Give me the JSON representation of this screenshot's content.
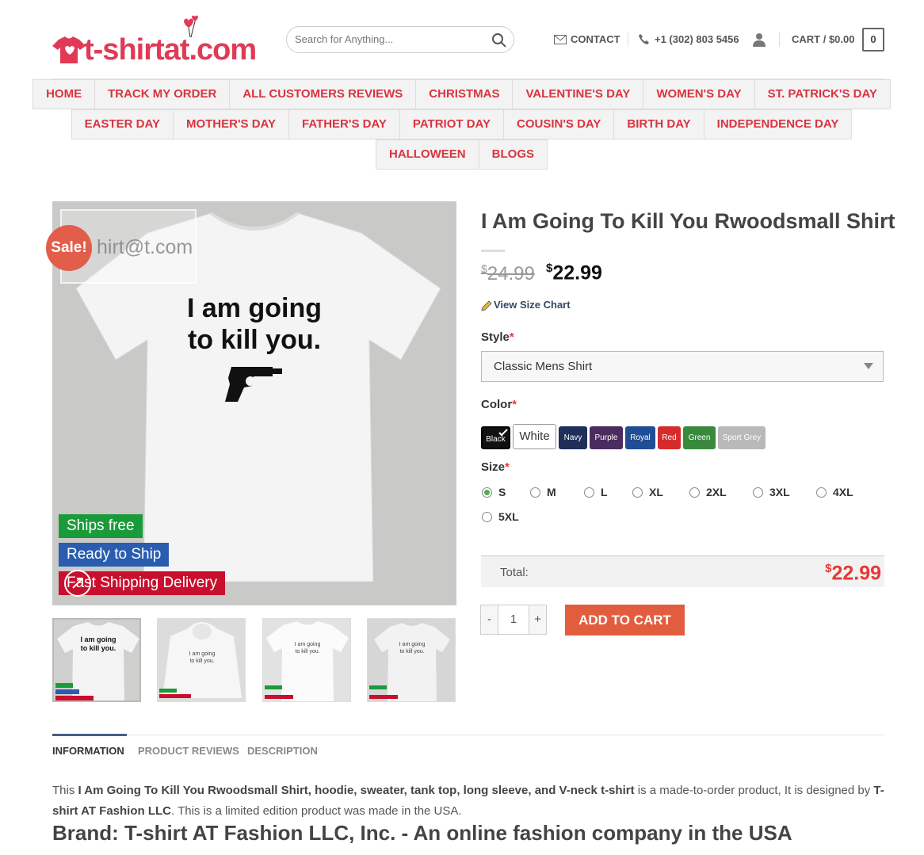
{
  "header": {
    "logo_text": "t-shirtat.com",
    "search_placeholder": "Search for Anything...",
    "contact_label": "CONTACT",
    "phone_label": "+1 (302) 803 5456",
    "cart_label": "CART / $0.00",
    "cart_count": "0"
  },
  "menu": {
    "row1": [
      "HOME",
      "TRACK MY ORDER",
      "ALL CUSTOMERS REVIEWS",
      "CHRISTMAS",
      "VALENTINE'S DAY",
      "WOMEN'S DAY",
      "ST. PATRICK'S DAY"
    ],
    "row2": [
      "EASTER DAY",
      "MOTHER'S DAY",
      "FATHER'S DAY",
      "PATRIOT DAY",
      "COUSIN'S DAY",
      "BIRTH DAY",
      "INDEPENDENCE DAY"
    ],
    "row3": [
      "HALLOWEEN",
      "BLOGS"
    ]
  },
  "gallery": {
    "sale_badge": "Sale!",
    "watermark": "hirt@t.com",
    "shirt_text_line1": "I am going",
    "shirt_text_line2": "to kill you.",
    "badges": [
      "Ships free",
      "Ready to Ship",
      "Fast Shipping Delivery"
    ],
    "thumb_text_line1": "I am going",
    "thumb_text_line2": "to kill you."
  },
  "product": {
    "title": "I Am Going To Kill You Rwoodsmall Shirt",
    "old_price_currency": "$",
    "old_price": "24.99",
    "price_currency": "$",
    "price": "22.99",
    "size_chart_link": "View Size Chart",
    "style_label": "Style",
    "style_selected": "Classic Mens Shirt",
    "color_label": "Color",
    "colors": [
      {
        "name": "Black",
        "hex": "#111111"
      },
      {
        "name": "White",
        "hex": "#ffffff"
      },
      {
        "name": "Navy",
        "hex": "#1f2f5a"
      },
      {
        "name": "Purple",
        "hex": "#4a2c5e"
      },
      {
        "name": "Royal",
        "hex": "#1f4d96"
      },
      {
        "name": "Red",
        "hex": "#d62b2b"
      },
      {
        "name": "Green",
        "hex": "#3a8a3e"
      },
      {
        "name": "Sport Grey",
        "hex": "#b9b9b9"
      }
    ],
    "selected_color": "Black",
    "size_label": "Size",
    "sizes": [
      "S",
      "M",
      "L",
      "XL",
      "2XL",
      "3XL",
      "4XL",
      "5XL"
    ],
    "selected_size": "S",
    "required_mark": "*",
    "total_label": "Total:",
    "total_currency": "$",
    "total_value": "22.99",
    "qty_minus": "-",
    "qty_value": "1",
    "qty_plus": "+",
    "add_to_cart": "ADD TO CART"
  },
  "tabs": [
    "INFORMATION",
    "PRODUCT REVIEWS",
    "DESCRIPTION"
  ],
  "description": {
    "p1_a": "This ",
    "p1_bold": "I Am Going To Kill You Rwoodsmall Shirt, hoodie, sweater, tank top, long sleeve, and V-neck t-shirt",
    "p1_b": " is a made-to-order product, It is designed by ",
    "p1_bold2": "T-shirt AT Fashion LLC",
    "p1_c": ". This is a limited edition product was made in the USA.",
    "brand": "Brand: T-shirt AT Fashion LLC, Inc. - An online fashion company in the USA"
  },
  "colors": {
    "accent_red": "#d8343f",
    "button_orange": "#e25d3e",
    "link_navy": "#334862"
  }
}
